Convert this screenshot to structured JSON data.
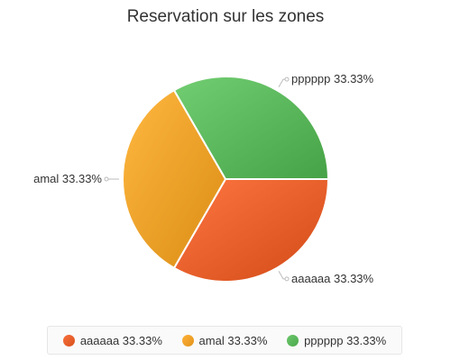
{
  "chart_data": {
    "type": "pie",
    "title": "Reservation sur les zones",
    "slices": [
      {
        "name": "aaaaaa",
        "value": 33.33,
        "label": "aaaaaa 33.33%",
        "color": "#e8602c"
      },
      {
        "name": "amal",
        "value": 33.33,
        "label": "amal 33.33%",
        "color": "#f0a22a"
      },
      {
        "name": "pppppp",
        "value": 33.33,
        "label": "pppppp 33.33%",
        "color": "#5cb85c"
      }
    ],
    "legend_position": "bottom-center"
  }
}
